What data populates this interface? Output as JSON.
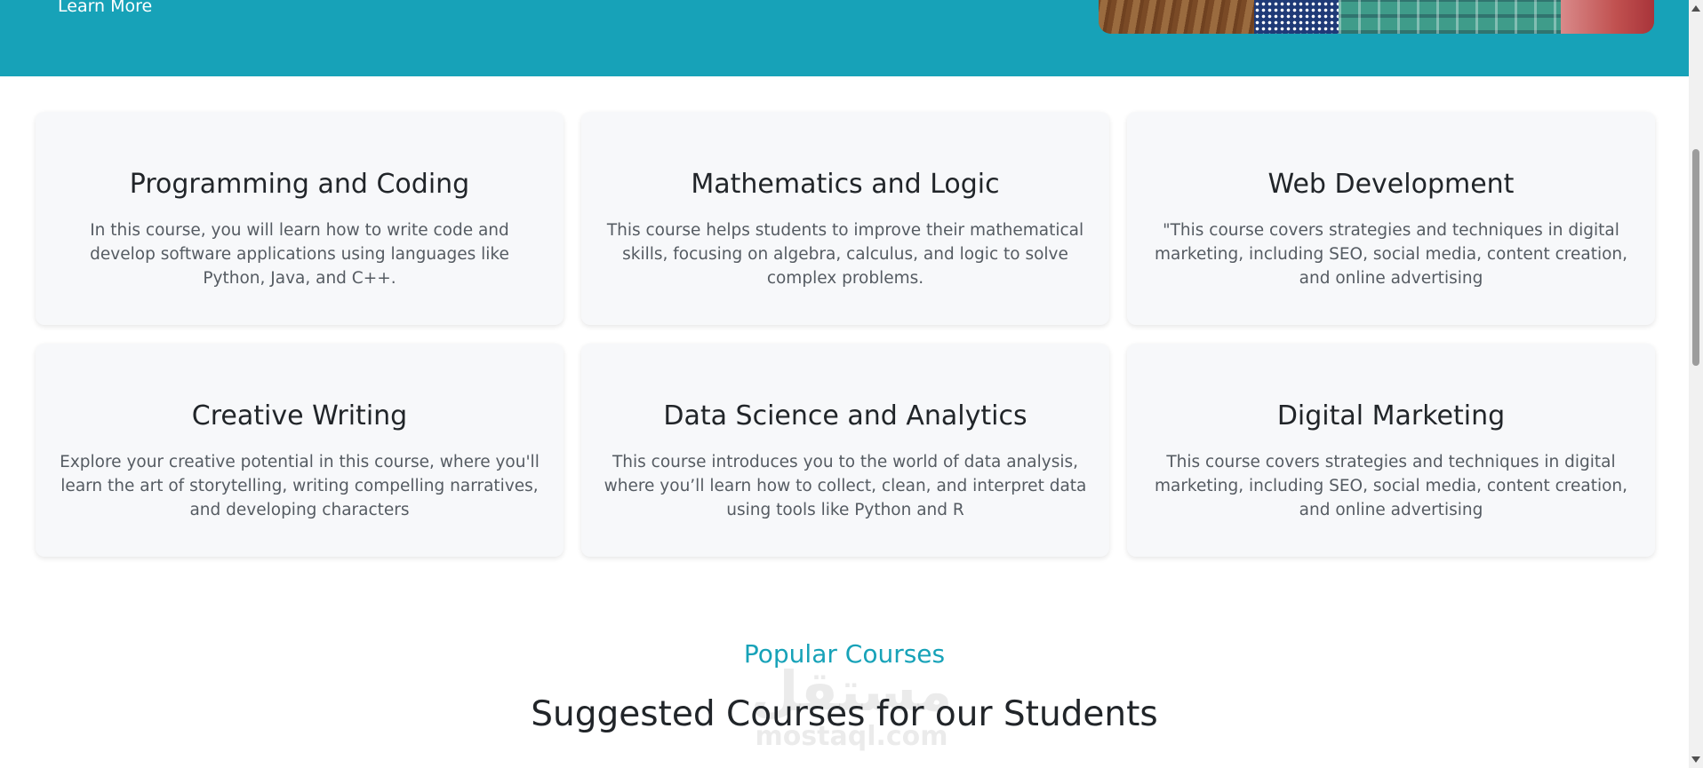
{
  "hero": {
    "link_label": "Learn More",
    "background": "#17a2b8"
  },
  "courses": [
    {
      "title": "Programming and Coding",
      "description": "In this course, you will learn how to write code and develop software applications using languages like Python, Java, and C++."
    },
    {
      "title": "Mathematics and Logic",
      "description": "This course helps students to improve their mathematical skills, focusing on algebra, calculus, and logic to solve complex problems."
    },
    {
      "title": "Web Development",
      "description": "\"This course covers strategies and techniques in digital marketing, including SEO, social media, content creation, and online advertising"
    },
    {
      "title": "Creative Writing",
      "description": "Explore your creative potential in this course, where you'll learn the art of storytelling, writing compelling narratives, and developing characters"
    },
    {
      "title": "Data Science and Analytics",
      "description": "This course introduces you to the world of data analysis, where you’ll learn how to collect, clean, and interpret data using tools like Python and R"
    },
    {
      "title": "Digital Marketing",
      "description": "This course covers strategies and techniques in digital marketing, including SEO, social media, content creation, and online advertising"
    }
  ],
  "section": {
    "eyebrow": "Popular Courses",
    "heading": "Suggested Courses for our Students"
  },
  "watermark": {
    "text": "مستقل",
    "subtext": "mostaql.com"
  },
  "colors": {
    "accent": "#17a2b8",
    "card_bg": "#f7f8fa",
    "heading": "#212529",
    "body_text": "#555b62"
  }
}
